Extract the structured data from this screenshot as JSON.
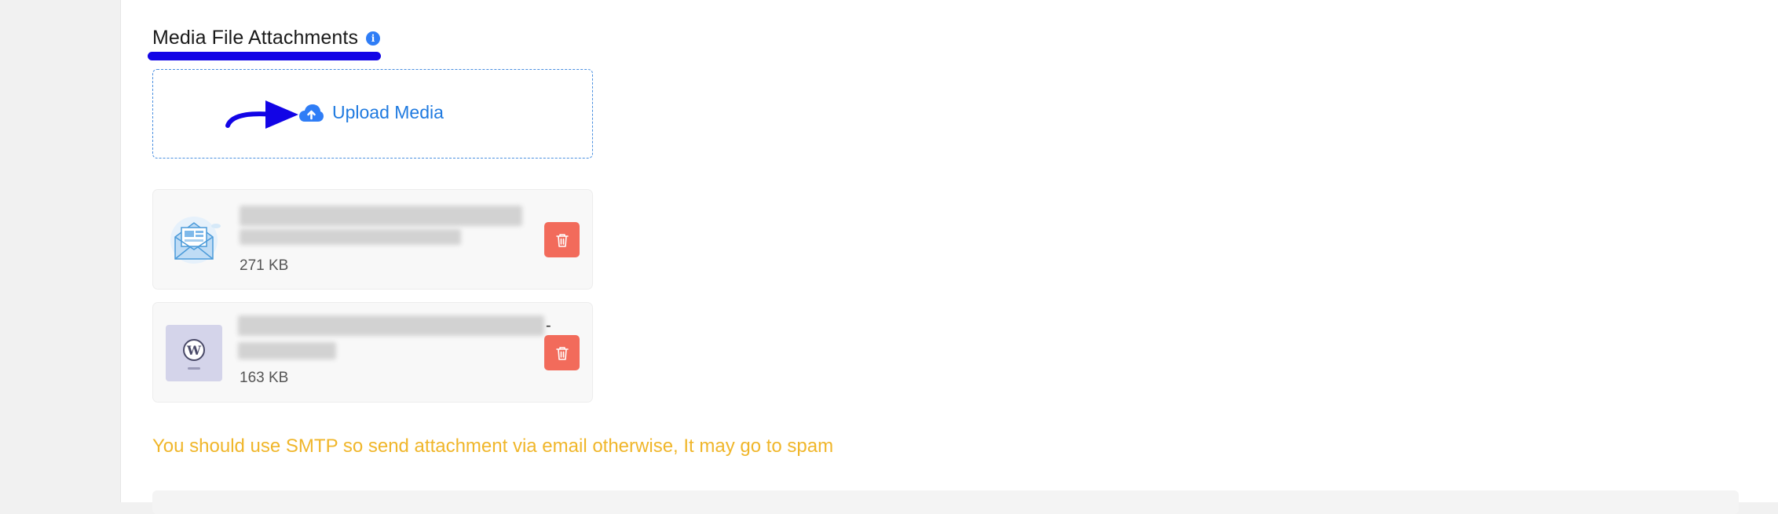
{
  "section": {
    "title": "Media File Attachments",
    "info_icon": "info-icon"
  },
  "upload": {
    "label": "Upload Media",
    "icon": "cloud-upload-icon"
  },
  "files": [
    {
      "size": "271 KB",
      "thumb_icon": "envelope-newsletter-icon"
    },
    {
      "size": "163 KB",
      "thumb_icon": "wordpress-logo-icon"
    }
  ],
  "warning": "You should use SMTP so send attachment via email otherwise, It may go to spam",
  "colors": {
    "accent_blue": "#1f7ae0",
    "annotation_blue": "#1204e6",
    "delete_red": "#f26b5b",
    "warning_yellow": "#f0b62a"
  }
}
